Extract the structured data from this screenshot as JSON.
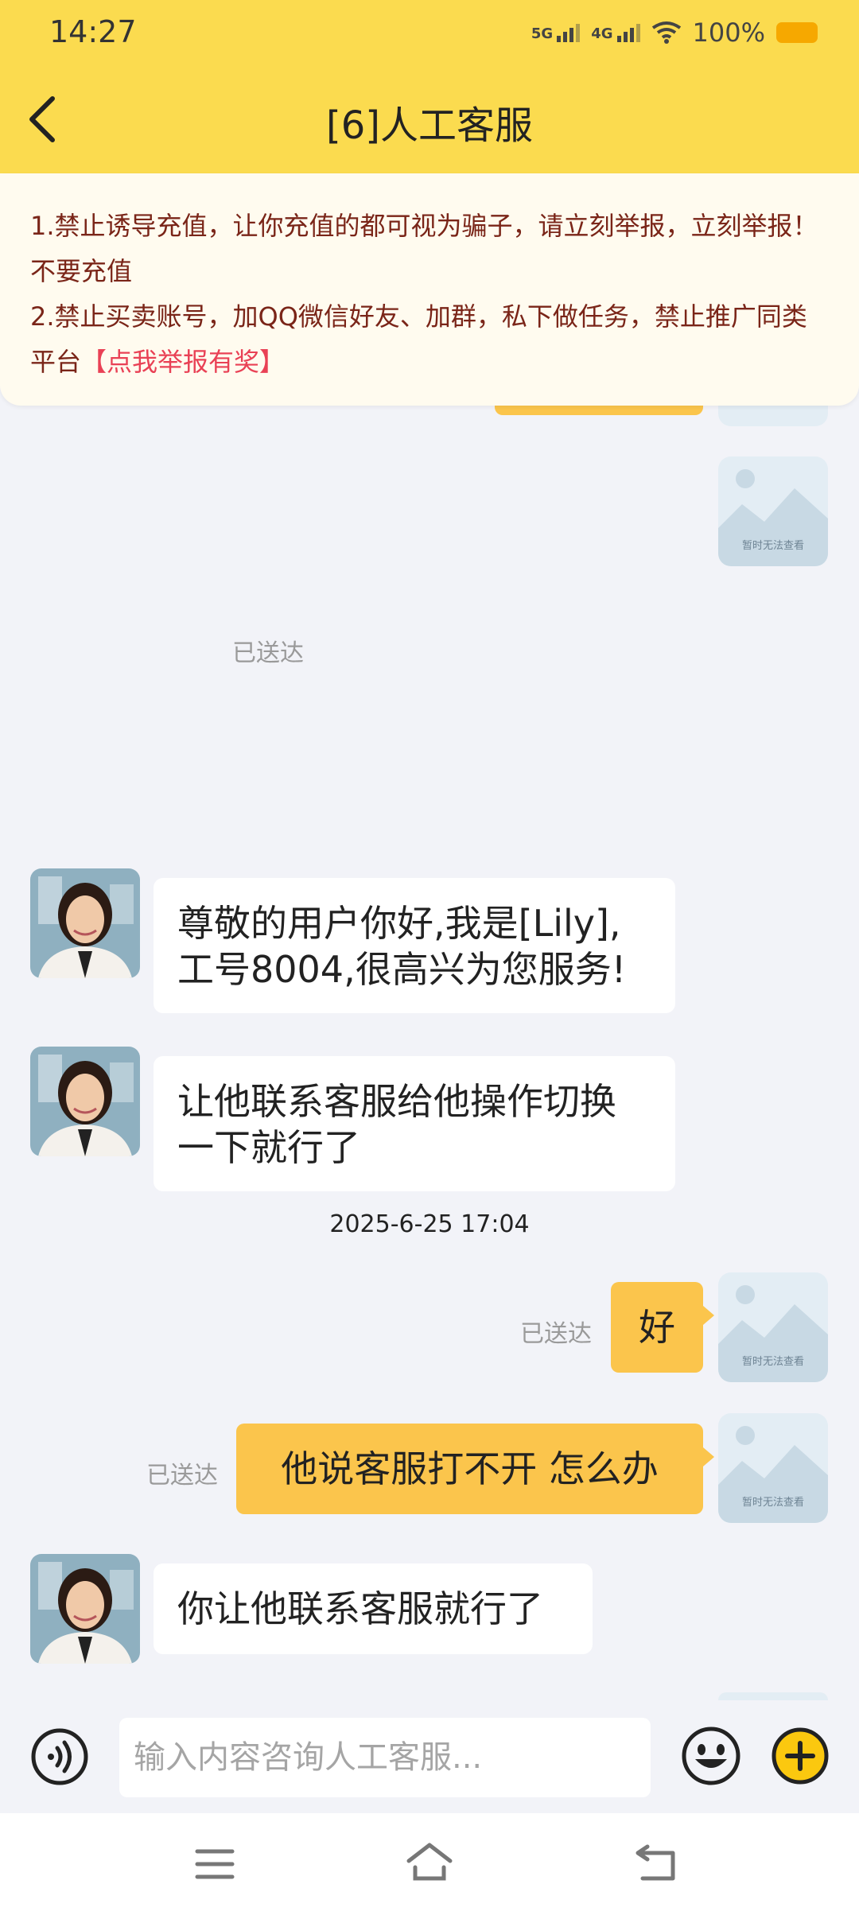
{
  "status_bar": {
    "time": "14:27",
    "net1": "5G",
    "net2": "4G",
    "battery": "100%"
  },
  "header": {
    "title": "[6]人工客服"
  },
  "notice": {
    "line1": "1.禁止诱导充值，让你充值的都可视为骗子，请立刻举报，立刻举报！不要充值",
    "line2": "2.禁止买卖账号，加QQ微信好友、加群，私下做任务，禁止推广同类平台",
    "link": "【点我举报有奖】"
  },
  "image_placeholder_text": "暂时无法查看",
  "messages": {
    "delivered_1": "已送达",
    "agent_1": "尊敬的用户你好,我是[Lily],工号8004,很高兴为您服务!",
    "agent_2": "让他联系客服给他操作切换一下就行了",
    "timestamp": "2025-6-25 17:04",
    "user_1": "好",
    "user_1_status": "已送达",
    "user_2": "他说客服打不开 怎么办",
    "user_2_status": "已送达",
    "agent_3": "你让他联系客服就行了"
  },
  "input": {
    "placeholder": "输入内容咨询人工客服..."
  },
  "icons": {
    "back": "chevron-left-icon",
    "voice": "voice-icon",
    "emoji": "emoji-icon",
    "plus": "plus-icon",
    "menu": "menu-icon",
    "home": "home-icon",
    "back_nav": "back-nav-icon"
  },
  "colors": {
    "header": "#fbdb4f",
    "user_bubble": "#fbc54c",
    "notice_text": "#7a2518",
    "notice_link": "#e94155"
  }
}
